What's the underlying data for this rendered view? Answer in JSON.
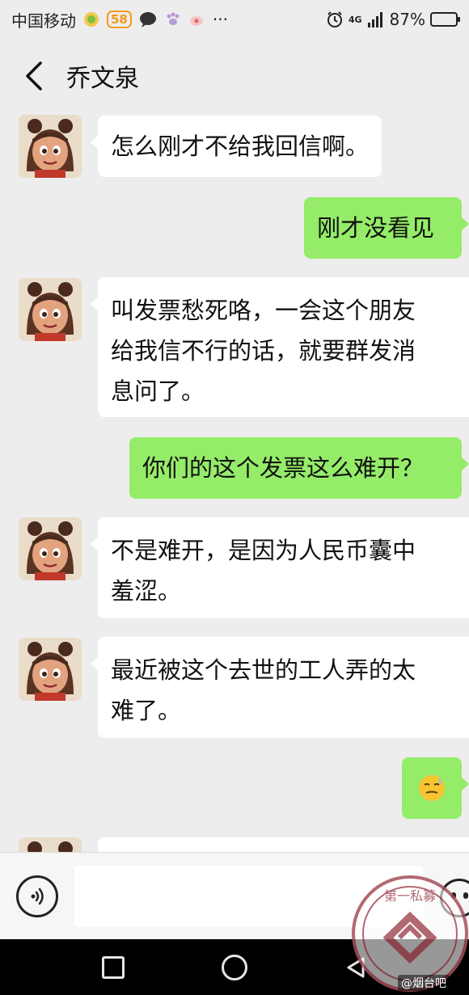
{
  "status_bar": {
    "carrier": "中国移动",
    "badge_58": "58",
    "network": "4G",
    "battery": "87%",
    "battery_level": 0.87,
    "more": "···"
  },
  "header": {
    "back_icon": "chevron-left-icon",
    "title": "乔文泉"
  },
  "messages": [
    {
      "side": "in",
      "lines": [
        "怎么刚才不给我回信啊。"
      ]
    },
    {
      "side": "out",
      "lines": [
        "刚才没看见"
      ]
    },
    {
      "side": "in",
      "lines": [
        "叫发票愁死咯，一会这个朋友",
        "给我信不行的话，就要群发消",
        "息问了。"
      ]
    },
    {
      "side": "out",
      "lines": [
        "你们的这个发票这么难开？"
      ]
    },
    {
      "side": "in",
      "lines": [
        "不是难开，是因为人民币囊中",
        "羞涩。"
      ]
    },
    {
      "side": "in",
      "lines": [
        "最近被这个去世的工人弄的太",
        "难了。"
      ]
    },
    {
      "side": "out",
      "lines": [],
      "emoji": "😓"
    }
  ],
  "input_bar": {
    "voice_icon": "voice-icon",
    "emoji_icon": "emoji-icon",
    "placeholder": ""
  },
  "nav_bar": {
    "items": [
      "recent-apps-icon",
      "home-icon",
      "back-icon"
    ]
  },
  "watermark": {
    "text": "第一私募",
    "caption": "@烟台吧"
  },
  "colors": {
    "background": "#ededed",
    "incoming_bubble": "#ffffff",
    "outgoing_bubble": "#95ec69",
    "input_bar": "#f6f6f6"
  }
}
